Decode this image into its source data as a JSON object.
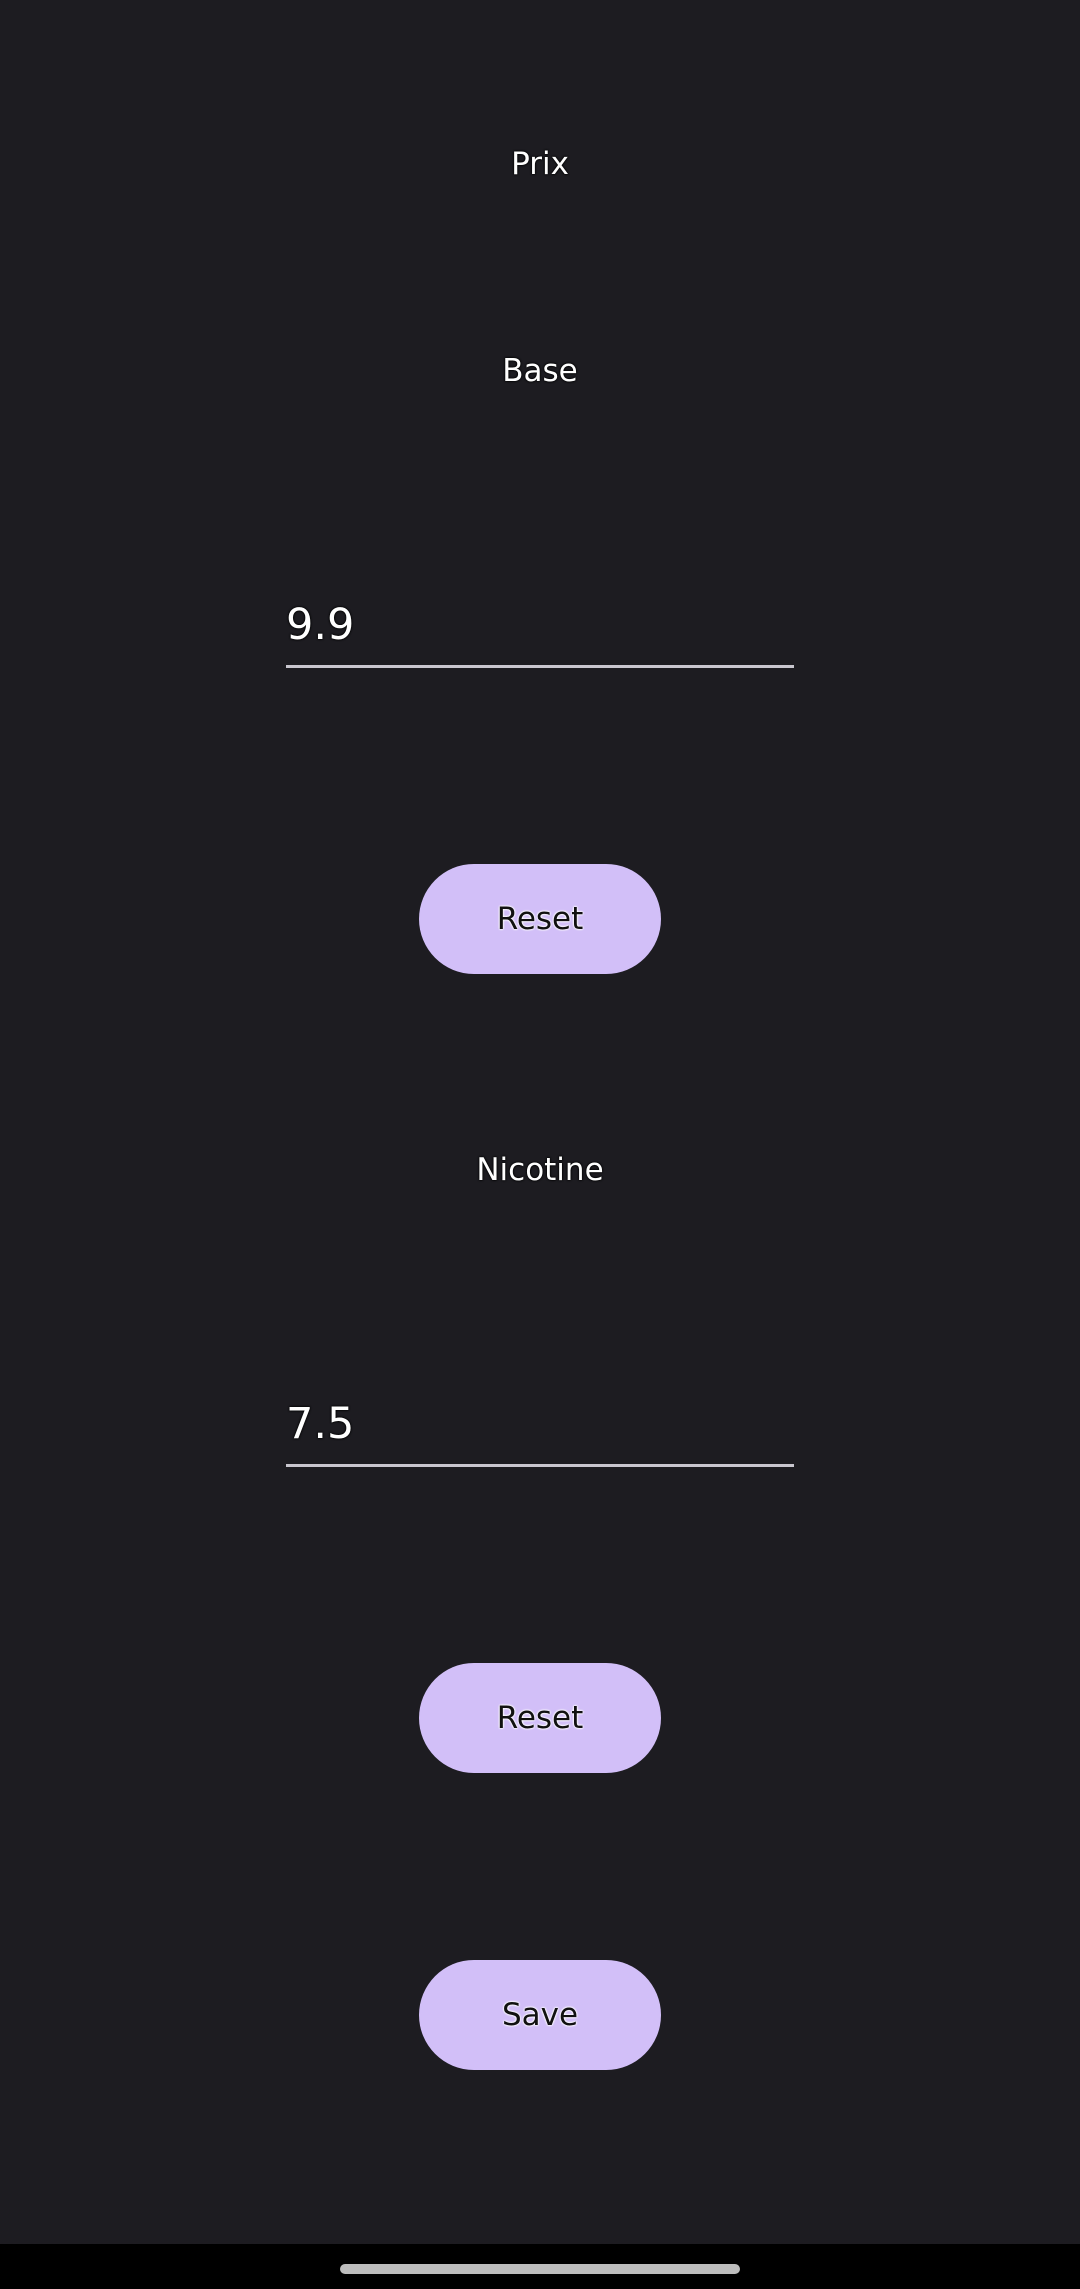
{
  "screen": {
    "title": "Prix"
  },
  "base": {
    "label": "Base",
    "value": "9.9",
    "reset_label": "Reset"
  },
  "nicotine": {
    "label": "Nicotine",
    "value": "7.5",
    "reset_label": "Reset"
  },
  "actions": {
    "save_label": "Save"
  },
  "colors": {
    "background": "#1d1c21",
    "button": "#d2bff8",
    "underline": "#c9c6cf",
    "nav_bar": "#000000"
  }
}
